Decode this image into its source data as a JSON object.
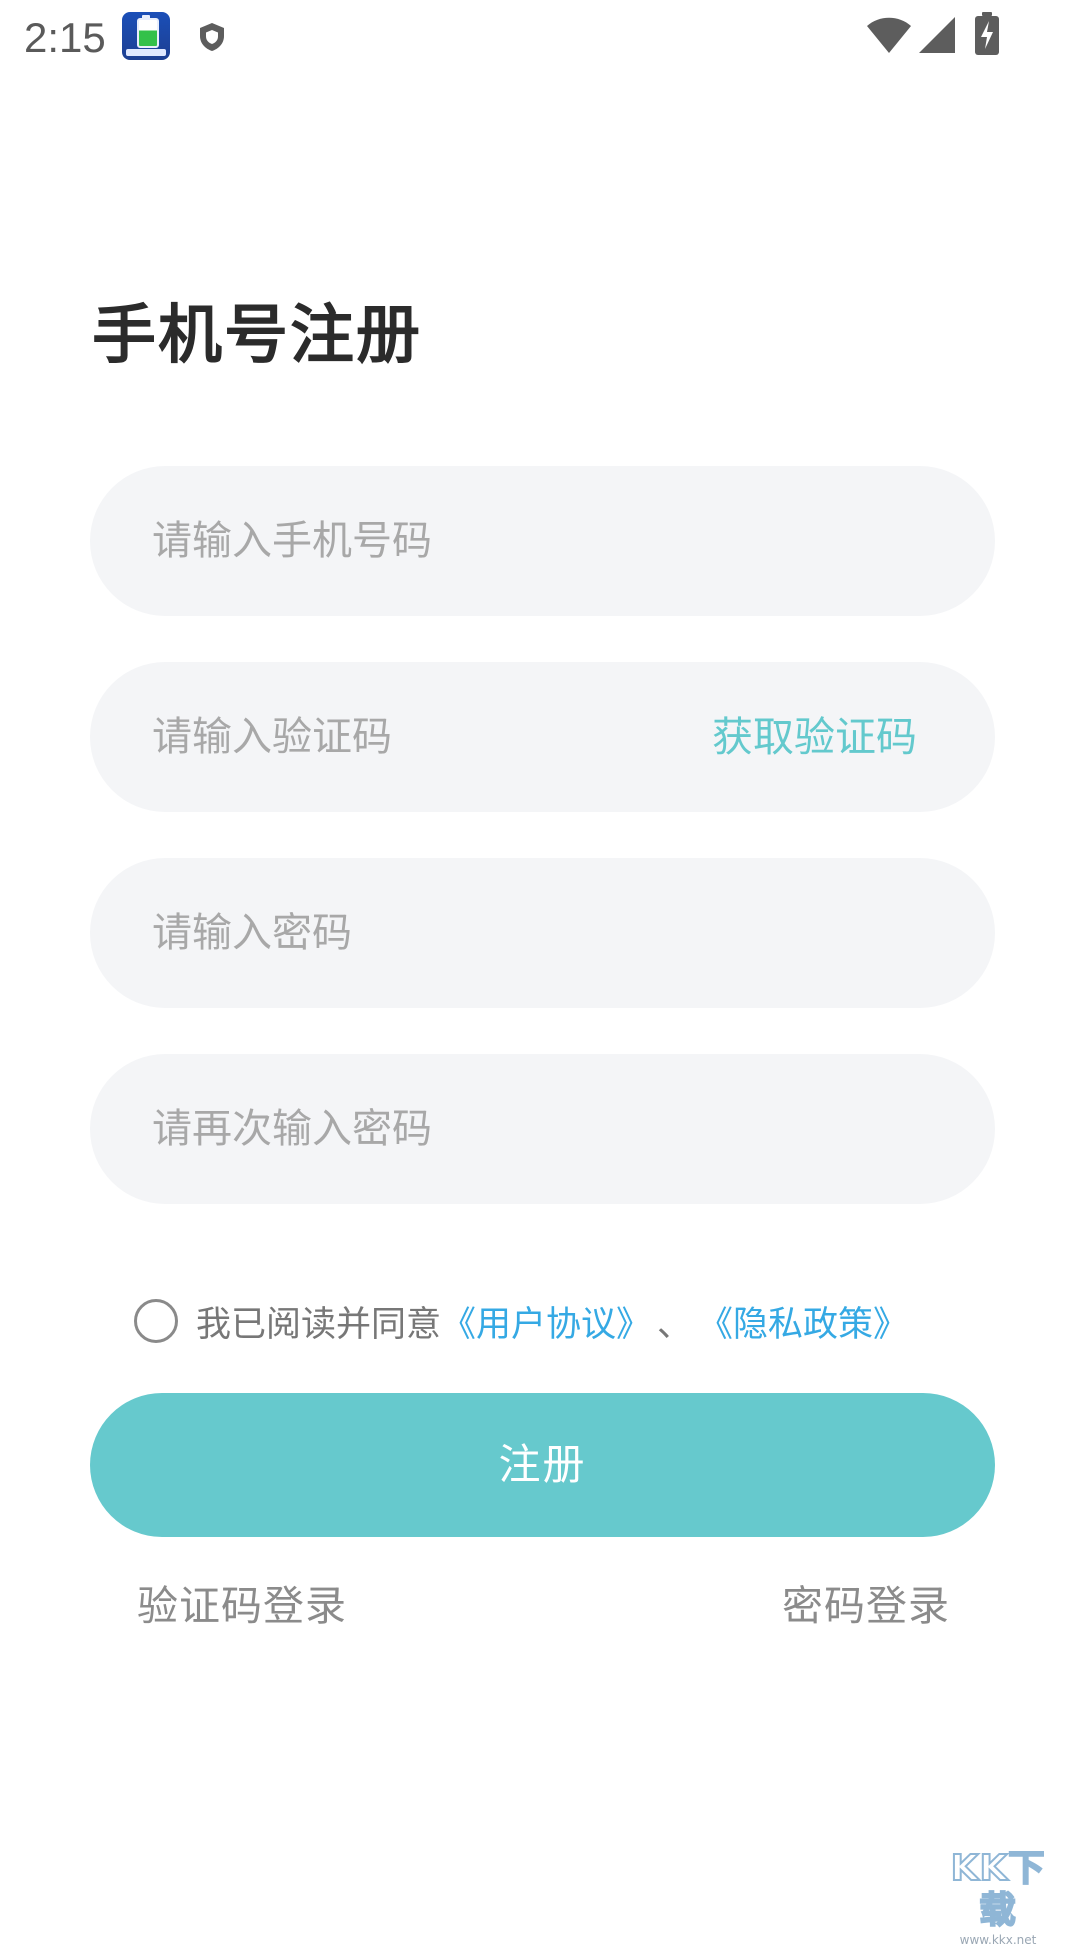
{
  "status_bar": {
    "time": "2:15"
  },
  "page": {
    "title": "手机号注册"
  },
  "form": {
    "phone_placeholder": "请输入手机号码",
    "code_placeholder": "请输入验证码",
    "get_code_label": "获取验证码",
    "password_placeholder": "请输入密码",
    "confirm_password_placeholder": "请再次输入密码"
  },
  "agreement": {
    "checked": false,
    "prefix": "我已阅读并同意",
    "user_agreement_link": "《用户协议》",
    "separator": "、",
    "privacy_policy_link": "《隐私政策》"
  },
  "register_button_label": "注册",
  "bottom_links": {
    "code_login": "验证码登录",
    "password_login": "密码登录"
  },
  "watermark": {
    "logo": "KK下载",
    "url": "www.kkx.net"
  },
  "colors": {
    "accent": "#66c9cd",
    "link": "#35a9e4",
    "field_background": "#f4f5f7"
  },
  "icons": {
    "app": "battery-app-icon",
    "shield": "shield-icon",
    "wifi": "wifi-icon",
    "signal": "signal-icon",
    "battery": "battery-charging-icon"
  }
}
